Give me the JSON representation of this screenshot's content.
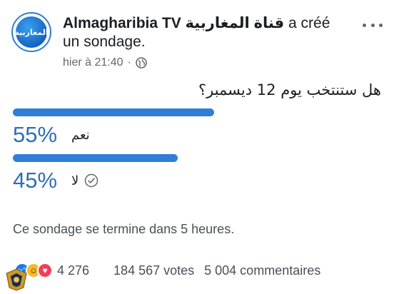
{
  "post": {
    "avatar_text": "المغاربية",
    "page_name": "Almagharibia TV قناة المغاربية",
    "action_text": " a créé un sondage.",
    "timestamp": "hier à 21:40",
    "separator": "·",
    "privacy_icon": "globe-icon",
    "more_icon": "more-options-icon"
  },
  "poll": {
    "question": "هل ستنتخب يوم 12 ديسمبر؟",
    "options": [
      {
        "percent_text": "55%",
        "label": "نعم",
        "fill_fraction": 0.55,
        "selected": false
      },
      {
        "percent_text": "45%",
        "label": "لا",
        "fill_fraction": 0.45,
        "selected": true
      }
    ],
    "end_note": "Ce sondage se termine dans 5 heures."
  },
  "stats": {
    "reactions": [
      "like-icon",
      "haha-icon",
      "love-icon"
    ],
    "reaction_count": "4 276",
    "votes": "184 567 votes",
    "comments": "5 004 commentaires"
  },
  "colors": {
    "bar": "#2f7ed8",
    "percent": "#2e6fb7",
    "like": "#1877f2",
    "haha": "#f7b928",
    "love": "#f33e58"
  }
}
